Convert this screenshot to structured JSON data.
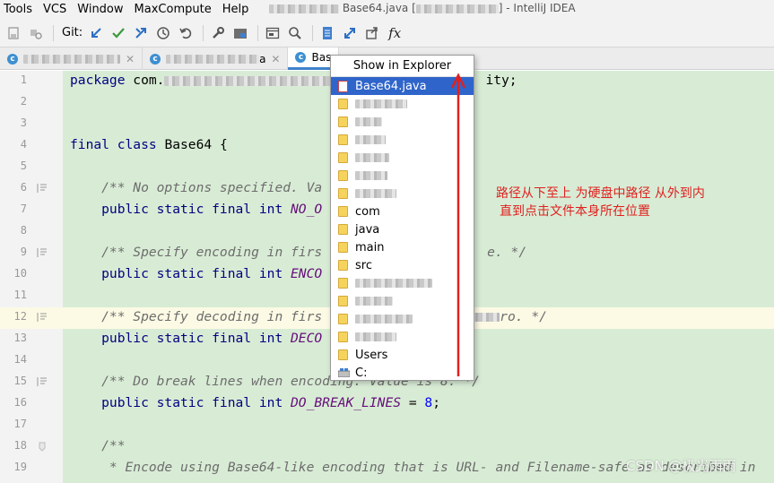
{
  "menu": {
    "items": [
      "Tools",
      "VCS",
      "Window",
      "MaxCompute",
      "Help"
    ],
    "window_title": "Base64.java [",
    "window_title_suffix": "] - IntelliJ IDEA"
  },
  "toolbar": {
    "git_label": "Git:",
    "icons": [
      "save-icon",
      "build-icon",
      "git-update-icon",
      "git-commit-icon",
      "git-push-icon",
      "history-icon",
      "revert-icon",
      "wrench-icon",
      "project-structure-icon",
      "terminal-icon",
      "search-icon",
      "bookmark-icon",
      "diff-icon",
      "share-icon",
      "function-icon"
    ]
  },
  "tabs": [
    {
      "label": "",
      "active": false
    },
    {
      "label": "a",
      "active": false
    },
    {
      "label": "Bas",
      "active": true
    }
  ],
  "editor": {
    "lines": [
      {
        "n": "1",
        "code": "package com."
      },
      {
        "n": "2",
        "code": ""
      },
      {
        "n": "3",
        "code": ""
      },
      {
        "n": "4",
        "code": "final class Base64 {"
      },
      {
        "n": "5",
        "code": ""
      },
      {
        "n": "6",
        "code": "    /** No options specified. Va"
      },
      {
        "n": "7",
        "code": "    public static final int NO_O"
      },
      {
        "n": "8",
        "code": ""
      },
      {
        "n": "9",
        "code": "    /** Specify encoding in firs"
      },
      {
        "n": "10",
        "code": "    public static final int ENCO"
      },
      {
        "n": "11",
        "code": ""
      },
      {
        "n": "12",
        "code": "    /** Specify decoding in firs"
      },
      {
        "n": "13",
        "code": "    public static final int DECO"
      },
      {
        "n": "14",
        "code": ""
      },
      {
        "n": "15",
        "code": "    /** Do break lines when encoding. Value is 8. */"
      },
      {
        "n": "16",
        "code": "    public static final int DO_BREAK_LINES = 8;"
      },
      {
        "n": "17",
        "code": ""
      },
      {
        "n": "18",
        "code": "    /**"
      },
      {
        "n": "19",
        "code": "     * Encode using Base64-like encoding that is URL- and Filename-safe as described in"
      }
    ],
    "fragments": {
      "line1_tail": "ity;",
      "line9_tail": "e. */",
      "line12_tail": "ro. */"
    }
  },
  "popup": {
    "title": "Show in Explorer",
    "items": [
      {
        "label": "Base64.java",
        "type": "file",
        "selected": true
      },
      {
        "label": "",
        "type": "folder"
      },
      {
        "label": "",
        "type": "folder"
      },
      {
        "label": "",
        "type": "folder"
      },
      {
        "label": "",
        "type": "folder"
      },
      {
        "label": "",
        "type": "folder"
      },
      {
        "label": "",
        "type": "folder"
      },
      {
        "label": "com",
        "type": "folder"
      },
      {
        "label": "java",
        "type": "folder"
      },
      {
        "label": "main",
        "type": "folder"
      },
      {
        "label": "src",
        "type": "folder"
      },
      {
        "label": "",
        "type": "folder"
      },
      {
        "label": "",
        "type": "folder"
      },
      {
        "label": "",
        "type": "folder"
      },
      {
        "label": "",
        "type": "folder"
      },
      {
        "label": "Users",
        "type": "folder"
      },
      {
        "label": "C:",
        "type": "drive"
      }
    ]
  },
  "annotation": {
    "line1": "路径从下至上  为硬盘中路径 从外到内",
    "line2": "直到点击文件本身所在位置",
    "color": "#e02020"
  },
  "watermark": "CSDN @极光雨雨"
}
